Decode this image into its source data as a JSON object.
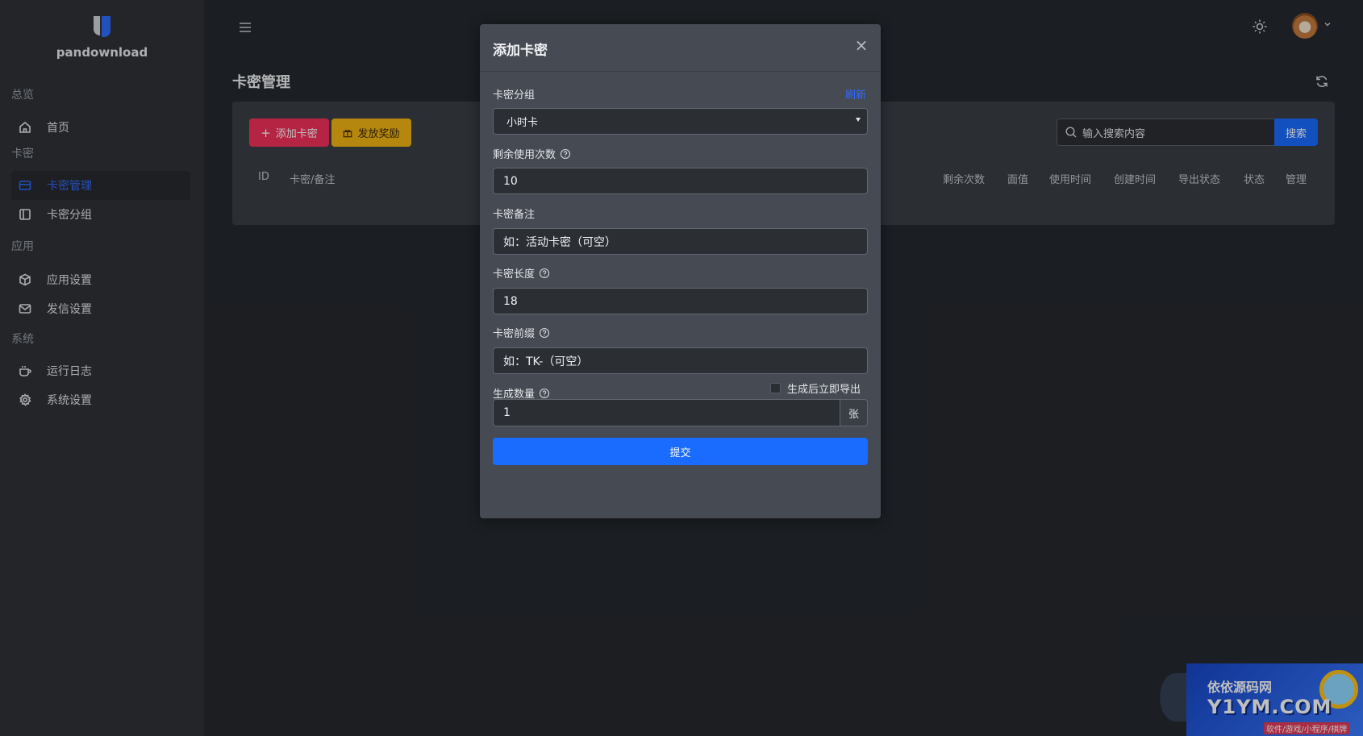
{
  "brand": {
    "name": "pandownload"
  },
  "sidebar": {
    "groups": [
      {
        "label": "总览"
      },
      {
        "label": "卡密"
      },
      {
        "label": "应用"
      },
      {
        "label": "系统"
      }
    ],
    "items": [
      {
        "label": "首页",
        "icon": "home-icon"
      },
      {
        "label": "卡密管理",
        "icon": "card-icon",
        "active": true
      },
      {
        "label": "卡密分组",
        "icon": "columns-icon"
      },
      {
        "label": "应用设置",
        "icon": "box-icon"
      },
      {
        "label": "发信设置",
        "icon": "mail-icon"
      },
      {
        "label": "运行日志",
        "icon": "cup-icon"
      },
      {
        "label": "系统设置",
        "icon": "gear-icon"
      }
    ]
  },
  "page": {
    "title": "卡密管理"
  },
  "toolbar": {
    "add_label": "添加卡密",
    "reward_label": "发放奖励",
    "search_placeholder": "输入搜索内容",
    "search_button": "搜索"
  },
  "table": {
    "columns": [
      "ID",
      "卡密/备注",
      "剩余次数",
      "面值",
      "使用时间",
      "创建时间",
      "导出状态",
      "状态",
      "管理"
    ]
  },
  "modal": {
    "title": "添加卡密",
    "close": "×",
    "group_label": "卡密分组",
    "group_refresh": "刷新",
    "group_value": "小时卡",
    "uses_label": "剩余使用次数",
    "uses_value": "10",
    "note_label": "卡密备注",
    "note_placeholder": "如：活动卡密（可空）",
    "length_label": "卡密长度",
    "length_value": "18",
    "prefix_label": "卡密前缀",
    "prefix_placeholder": "如：TK-（可空）",
    "qty_label": "生成数量",
    "export_label": "生成后立即导出",
    "export_checked": false,
    "qty_value": "1",
    "qty_unit": "张",
    "submit_label": "提交"
  },
  "watermark": {
    "line1": "依依源码网",
    "line2": "Y1YM.COM",
    "line3": "软件/游戏/小程序/棋牌"
  },
  "colors": {
    "accent": "#1a6bff",
    "danger": "#f2325a",
    "warning": "#f2b415",
    "sidebar_bg": "#2f3237",
    "main_bg": "#25282e"
  }
}
